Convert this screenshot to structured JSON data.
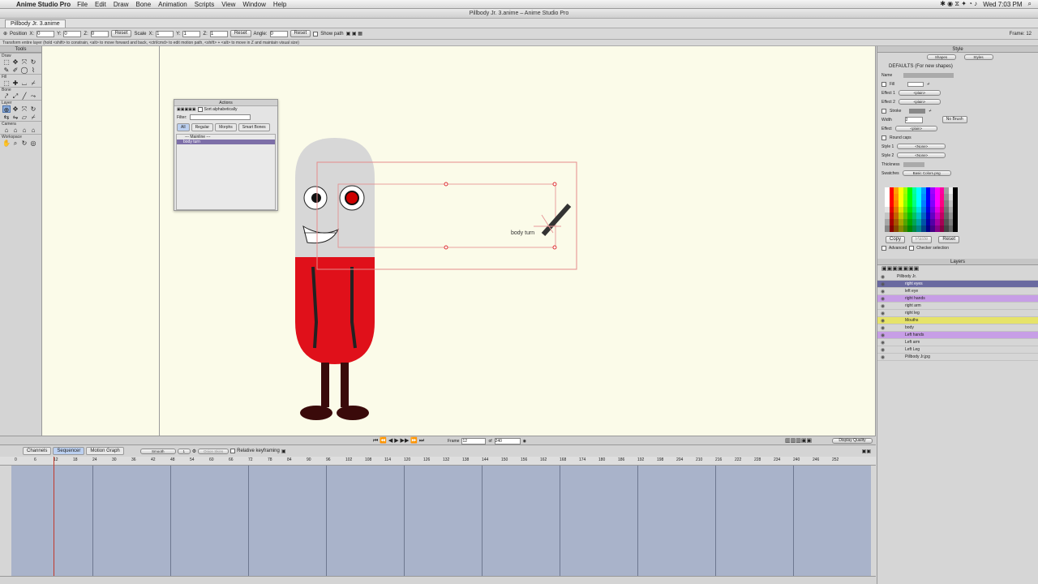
{
  "menubar": {
    "app_name": "Anime Studio Pro",
    "items": [
      "File",
      "Edit",
      "Draw",
      "Bone",
      "Animation",
      "Scripts",
      "View",
      "Window",
      "Help"
    ],
    "clock": "Wed 7:03 PM"
  },
  "window": {
    "title": "Pillbody Jr. 3.anime – Anime Studio Pro",
    "doc_tab": "Pillbody Jr. 3.anime"
  },
  "options_bar": {
    "position_label": "Position",
    "x_label": "X:",
    "x_value": "0",
    "y_label": "Y:",
    "y_value": "0",
    "z_label": "Z:",
    "z_value": "0",
    "reset1": "Reset",
    "scale_label": "Scale",
    "sx_label": "X:",
    "sx_value": "1",
    "sy_label": "Y:",
    "sy_value": "1",
    "sz_label": "Z:",
    "sz_value": "1",
    "reset2": "Reset",
    "angle_label": "Angle:",
    "angle_value": "0",
    "reset3": "Reset",
    "show_path": "Show path",
    "frame_indicator": "Frame: 12"
  },
  "hint": "Transform entire layer (hold <shift> to constrain, <alt> to move forward and back, <ctrl/cmd> to edit motion path, <shift> + <alt> to move in Z and maintain visual size)",
  "tools": {
    "header": "Tools",
    "sections": [
      "Draw",
      "Fill",
      "Bone",
      "Layer",
      "Camera",
      "Workspace"
    ]
  },
  "actions_panel": {
    "title": "Actions",
    "sort_label": "Sort alphabetically",
    "filter_label": "Filter:",
    "tabs": [
      "All",
      "Regular",
      "Morphs",
      "Smart Bones"
    ],
    "mainline": "--- Mainline ---",
    "selected_item": "body turn"
  },
  "canvas": {
    "bone_label": "body turn"
  },
  "style_panel": {
    "header": "Style",
    "shapes_btn": "Shapes",
    "styles_btn": "Styles",
    "defaults": "DEFAULTS (For new shapes)",
    "name_label": "Name",
    "fill_label": "Fill",
    "effect1_label": "Effect 1",
    "effect1_value": "<plain>",
    "effect2_label": "Effect 2",
    "effect2_value": "<plain>",
    "stroke_label": "Stroke",
    "width_label": "Width",
    "width_value": "2",
    "no_brush": "No Brush",
    "effect_label": "Effect",
    "effect_value": "<plain>",
    "round_caps": "Round caps",
    "style1_label": "Style 1",
    "style1_value": "<None>",
    "style2_label": "Style 2",
    "style2_value": "<None>",
    "thickness_label": "Thickness",
    "swatches_label": "Swatches",
    "swatches_value": "Basic Colors.png",
    "copy_btn": "Copy",
    "paste_btn": "Paste",
    "reset_btn": "Reset",
    "advanced": "Advanced",
    "checker": "Checker selection"
  },
  "layers_panel": {
    "header": "Layers",
    "rows": [
      {
        "name": "Pillbody Jr.",
        "color": "#d6d6d6"
      },
      {
        "name": "right eyes",
        "color": "#6a6aa0"
      },
      {
        "name": "left eye",
        "color": "#d6d6d6"
      },
      {
        "name": "right hands",
        "color": "#c79ee6"
      },
      {
        "name": "right arm",
        "color": "#d6d6d6"
      },
      {
        "name": "right leg",
        "color": "#d6d6d6"
      },
      {
        "name": "Mouths",
        "color": "#e6e36a"
      },
      {
        "name": "body",
        "color": "#d6d6d6"
      },
      {
        "name": "Left hands",
        "color": "#c79ee6"
      },
      {
        "name": "Left arm",
        "color": "#d6d6d6"
      },
      {
        "name": "Left Leg",
        "color": "#d6d6d6"
      },
      {
        "name": "Pillbody Jr.jpg",
        "color": "#d6d6d6"
      }
    ]
  },
  "timeline": {
    "frame_label": "Frame",
    "frame_value": "12",
    "of_label": "of",
    "total_value": "240",
    "quality_btn": "Display Quality",
    "tabs": [
      "Channels",
      "Sequencer",
      "Motion Graph"
    ],
    "interp": "Smooth",
    "interp_num": "1",
    "onion": "Onion Skins",
    "relative": "Relative keyframing",
    "ruler": [
      "0",
      "6",
      "12",
      "18",
      "24",
      "30",
      "36",
      "42",
      "48",
      "54",
      "60",
      "66",
      "72",
      "78",
      "84",
      "90",
      "96",
      "102",
      "108",
      "114",
      "120",
      "126",
      "132",
      "138",
      "144",
      "150",
      "156",
      "162",
      "168",
      "174",
      "180",
      "186",
      "192",
      "198",
      "204",
      "210",
      "216",
      "222",
      "228",
      "234",
      "240",
      "246",
      "252"
    ]
  },
  "swatch_colors": [
    "#ffffff",
    "#ff0000",
    "#ff8000",
    "#ffff00",
    "#80ff00",
    "#00ff00",
    "#00ff80",
    "#00ffff",
    "#0080ff",
    "#0000ff",
    "#8000ff",
    "#ff00ff",
    "#ff0080",
    "#808080",
    "#c0c0c0",
    "#000000"
  ]
}
